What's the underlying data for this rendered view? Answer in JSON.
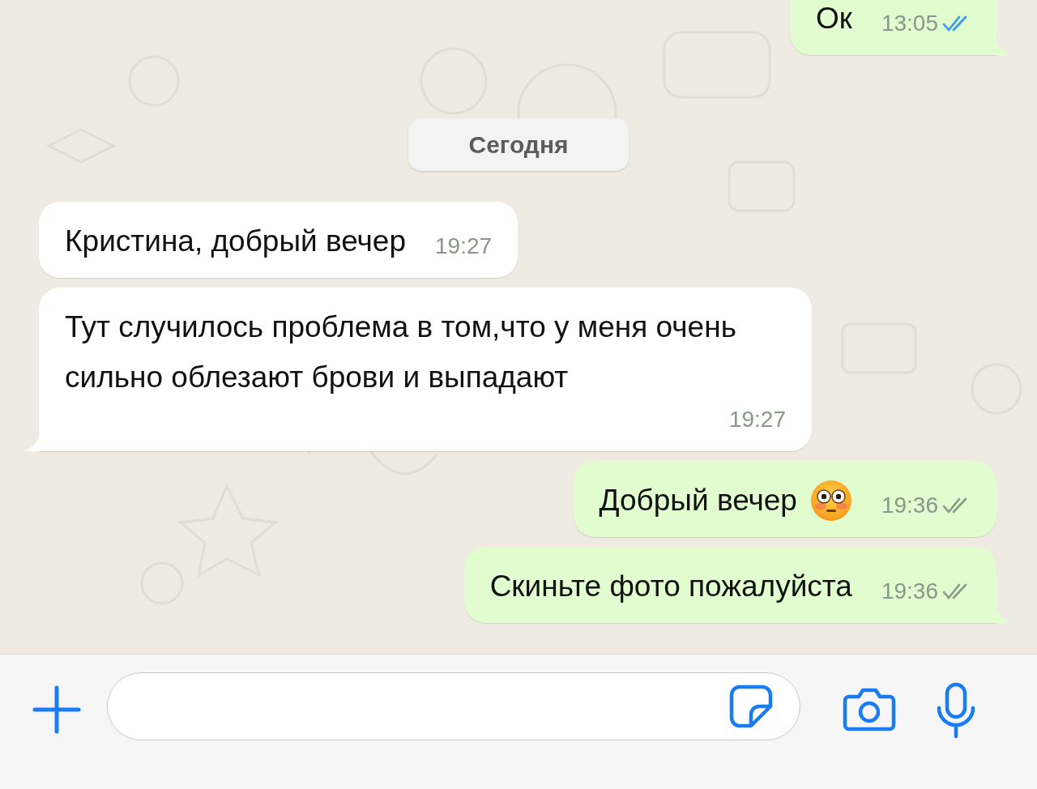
{
  "messages": [
    {
      "kind": "outgoing",
      "text": "Ок",
      "time": "13:05",
      "read": true,
      "tail": true,
      "emoji": false
    },
    {
      "kind": "date",
      "text": "Сегодня"
    },
    {
      "kind": "incoming",
      "text": "Кристина, добрый вечер",
      "time": "19:27",
      "tail": false,
      "emoji": false
    },
    {
      "kind": "incoming",
      "text": "Тут случилось проблема в том,что у меня очень сильно облезают брови и выпадают",
      "time": "19:27",
      "tail": true,
      "emoji": false
    },
    {
      "kind": "outgoing",
      "text": "Добрый вечер",
      "time": "19:36",
      "read": false,
      "tail": false,
      "emoji": true
    },
    {
      "kind": "outgoing",
      "text": "Скиньте фото пожалуйста",
      "time": "19:36",
      "read": false,
      "tail": true,
      "emoji": false
    }
  ]
}
